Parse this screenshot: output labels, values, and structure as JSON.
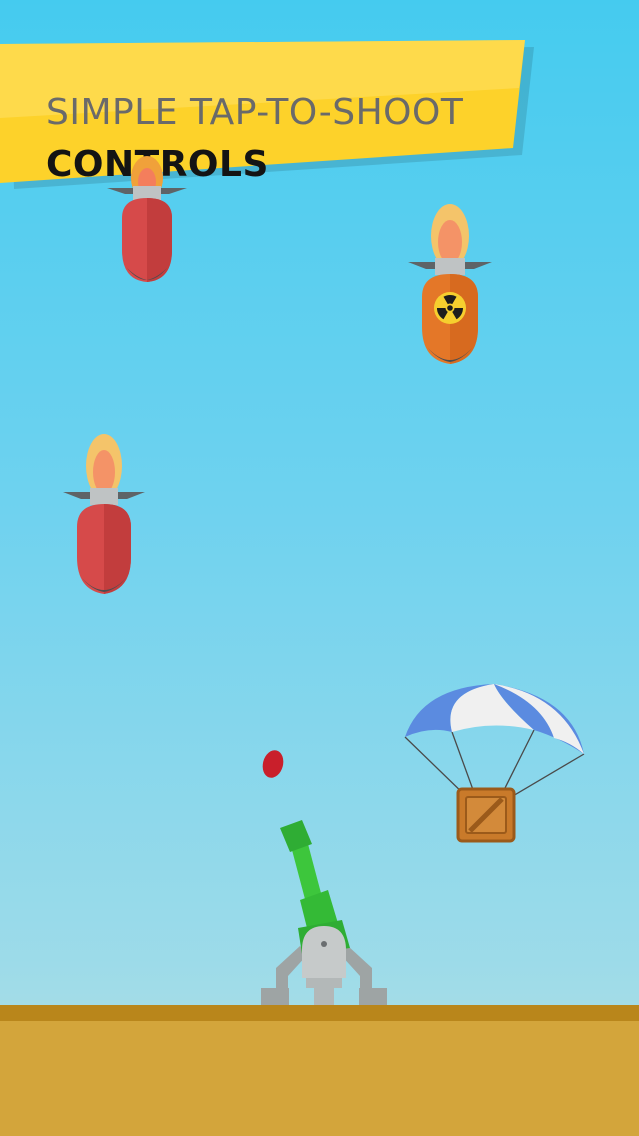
{
  "banner": {
    "line1": "SIMPLE TAP-TO-SHOOT",
    "line2": "CONTROLS"
  },
  "game": {
    "enemies": [
      {
        "type": "bomb",
        "color": "#d64a4a"
      },
      {
        "type": "nuclear-bomb",
        "color": "#e47728",
        "icon": "radiation-icon"
      },
      {
        "type": "bomb",
        "color": "#d64a4a"
      }
    ],
    "projectile": {
      "color": "#c91f2b"
    },
    "supply_drop": {
      "icon": "parachute-crate-icon",
      "canopy_colors": [
        "#5b8be0",
        "#f0f0f0"
      ],
      "crate_color": "#c97a2a"
    },
    "player": {
      "icon": "cannon-icon",
      "barrel_color": "#3dc63c",
      "base_color": "#9ea4a4"
    },
    "ground_color": "#d3a53b"
  }
}
